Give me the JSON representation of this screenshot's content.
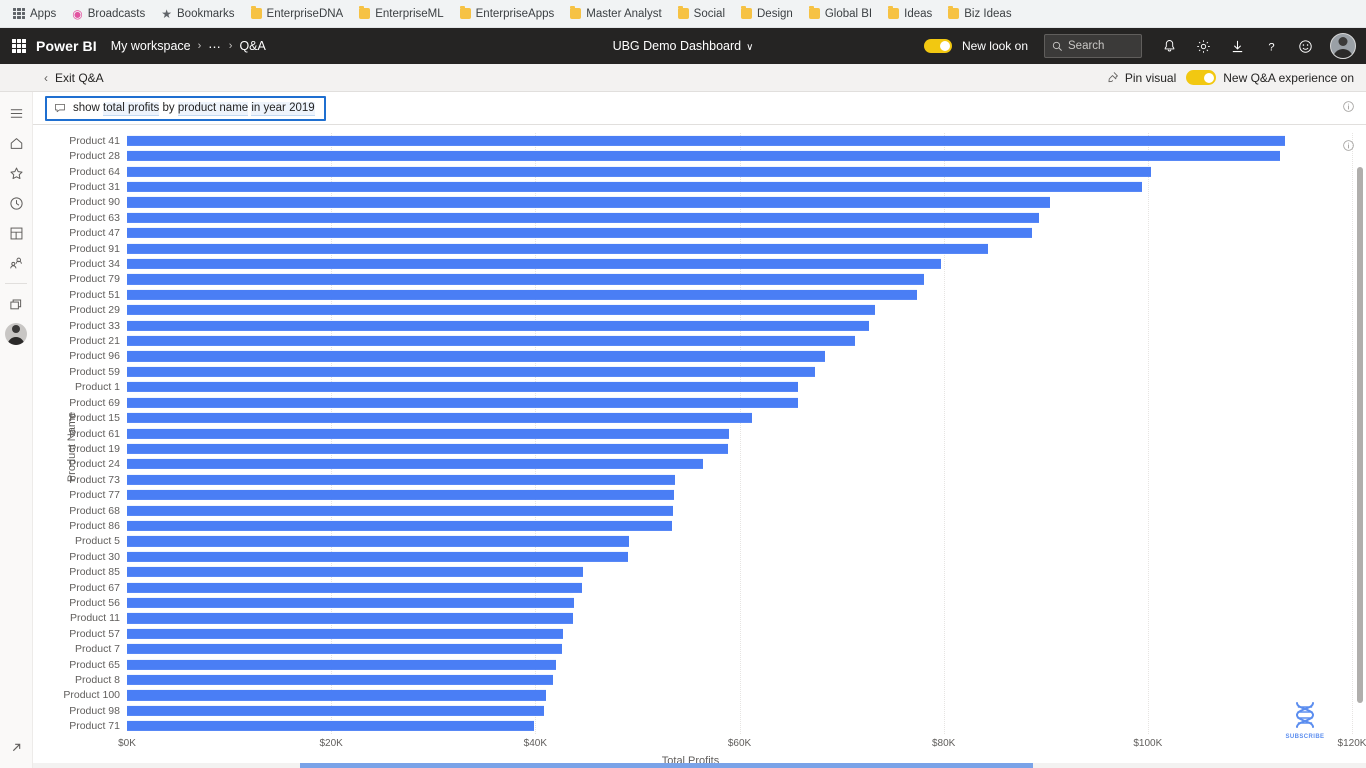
{
  "browser": {
    "bookmarks": [
      {
        "label": "Apps",
        "icon": "apps-grid-icon"
      },
      {
        "label": "Broadcasts",
        "icon": "broadcast-icon"
      },
      {
        "label": "Bookmarks",
        "icon": "star-icon"
      },
      {
        "label": "EnterpriseDNA",
        "icon": "folder-icon"
      },
      {
        "label": "EnterpriseML",
        "icon": "folder-icon"
      },
      {
        "label": "EnterpriseApps",
        "icon": "folder-icon"
      },
      {
        "label": "Master Analyst",
        "icon": "folder-icon"
      },
      {
        "label": "Social",
        "icon": "folder-icon"
      },
      {
        "label": "Design",
        "icon": "folder-icon"
      },
      {
        "label": "Global BI",
        "icon": "folder-icon"
      },
      {
        "label": "Ideas",
        "icon": "folder-icon"
      },
      {
        "label": "Biz Ideas",
        "icon": "folder-icon"
      }
    ]
  },
  "header": {
    "waffle_icon": "app-launcher-icon",
    "brand": "Power BI",
    "breadcrumbs": [
      {
        "label": "My workspace"
      },
      {
        "label": "⋯"
      },
      {
        "label": "Q&A"
      }
    ],
    "separator": "›",
    "document_title": "UBG Demo Dashboard",
    "document_chevron": "∨",
    "new_look_toggle": {
      "label": "New look on",
      "state": "on",
      "color": "#f2c811"
    },
    "search": {
      "placeholder": "Search",
      "value": ""
    },
    "icons": [
      {
        "name": "notifications-icon"
      },
      {
        "name": "settings-gear-icon"
      },
      {
        "name": "download-icon"
      },
      {
        "name": "help-question-icon"
      },
      {
        "name": "feedback-smiley-icon"
      }
    ],
    "avatar": "user-avatar"
  },
  "qa_bar": {
    "exit_label": "Exit Q&A",
    "back_arrow": "‹",
    "pin_visual_label": "Pin visual",
    "new_experience_label": "New Q&A experience on",
    "new_experience_state": "on"
  },
  "rail": {
    "items": [
      {
        "name": "navigation-hamburger-icon",
        "label": "Navigation"
      },
      {
        "name": "home-icon",
        "label": "Home"
      },
      {
        "name": "favorites-star-icon",
        "label": "Favorites"
      },
      {
        "name": "recent-clock-icon",
        "label": "Recent"
      },
      {
        "name": "apps-icon",
        "label": "Apps"
      },
      {
        "name": "shared-with-me-icon",
        "label": "Shared with me"
      },
      {
        "name": "workspaces-icon",
        "label": "Workspaces"
      },
      {
        "name": "my-workspace-avatar",
        "label": "My workspace"
      }
    ],
    "expand_icon": "expand-arrow-icon"
  },
  "question": {
    "bubble_icon": "chat-bubble-icon",
    "segments": [
      {
        "text": "show ",
        "highlight": false
      },
      {
        "text": "total profits",
        "highlight": true
      },
      {
        "text": " by ",
        "highlight": false
      },
      {
        "text": "product name",
        "highlight": true
      },
      {
        "text": " ",
        "highlight": false
      },
      {
        "text": "in year 2019",
        "highlight": true
      }
    ],
    "full_text": "show total profits by product name in year 2019",
    "info_icon": "info-circle-icon",
    "info_icon_2": "info-circle-icon"
  },
  "watermark": {
    "logo": "dna-helix-icon",
    "label": "SUBSCRIBE",
    "color": "#5b8def"
  },
  "chart_data": {
    "type": "bar",
    "orientation": "horizontal",
    "title": "",
    "xlabel": "Total Profits",
    "ylabel": "Product Name",
    "xlim": [
      0,
      120000
    ],
    "xticks": [
      0,
      20000,
      40000,
      60000,
      80000,
      100000,
      120000
    ],
    "xtick_labels": [
      "$0K",
      "$20K",
      "$40K",
      "$60K",
      "$80K",
      "$100K",
      "$120K"
    ],
    "grid": true,
    "bar_color": "#4a7ef5",
    "legend": "none",
    "categories": [
      "Product 41",
      "Product 28",
      "Product 64",
      "Product 31",
      "Product 90",
      "Product 63",
      "Product 47",
      "Product 91",
      "Product 34",
      "Product 79",
      "Product 51",
      "Product 29",
      "Product 33",
      "Product 21",
      "Product 96",
      "Product 59",
      "Product 1",
      "Product 69",
      "Product 15",
      "Product 61",
      "Product 19",
      "Product 24",
      "Product 73",
      "Product 77",
      "Product 68",
      "Product 86",
      "Product 5",
      "Product 30",
      "Product 85",
      "Product 67",
      "Product 56",
      "Product 11",
      "Product 57",
      "Product 7",
      "Product 65",
      "Product 8",
      "Product 100",
      "Product 98",
      "Product 71"
    ],
    "values": [
      113400,
      112900,
      100300,
      99400,
      90400,
      89300,
      88700,
      84300,
      79700,
      78100,
      77400,
      73300,
      72700,
      71300,
      68400,
      67400,
      65700,
      65700,
      61200,
      59000,
      58900,
      56400,
      53700,
      53600,
      53500,
      53400,
      49200,
      49100,
      44700,
      44600,
      43800,
      43700,
      42700,
      42600,
      42000,
      41700,
      41000,
      40800,
      39900
    ],
    "value_unit": "USD"
  }
}
